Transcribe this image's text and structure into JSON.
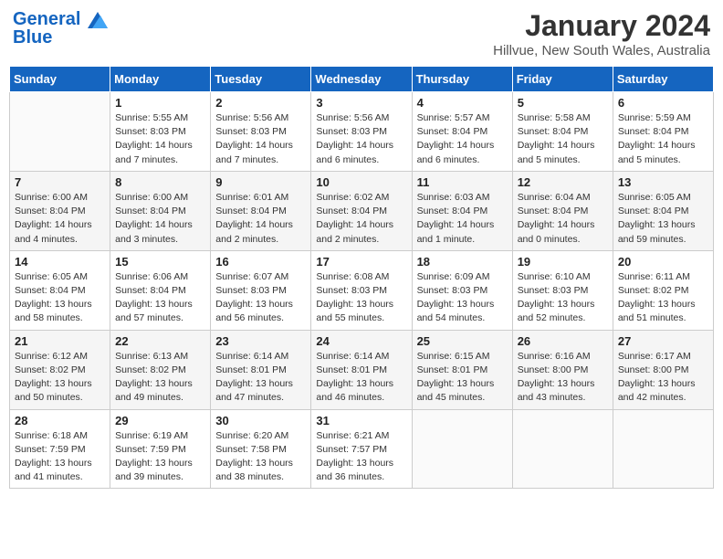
{
  "header": {
    "logo_line1": "General",
    "logo_line2": "Blue",
    "month": "January 2024",
    "location": "Hillvue, New South Wales, Australia"
  },
  "days_of_week": [
    "Sunday",
    "Monday",
    "Tuesday",
    "Wednesday",
    "Thursday",
    "Friday",
    "Saturday"
  ],
  "weeks": [
    [
      {
        "day": "",
        "sunrise": "",
        "sunset": "",
        "daylight": ""
      },
      {
        "day": "1",
        "sunrise": "Sunrise: 5:55 AM",
        "sunset": "Sunset: 8:03 PM",
        "daylight": "Daylight: 14 hours and 7 minutes."
      },
      {
        "day": "2",
        "sunrise": "Sunrise: 5:56 AM",
        "sunset": "Sunset: 8:03 PM",
        "daylight": "Daylight: 14 hours and 7 minutes."
      },
      {
        "day": "3",
        "sunrise": "Sunrise: 5:56 AM",
        "sunset": "Sunset: 8:03 PM",
        "daylight": "Daylight: 14 hours and 6 minutes."
      },
      {
        "day": "4",
        "sunrise": "Sunrise: 5:57 AM",
        "sunset": "Sunset: 8:04 PM",
        "daylight": "Daylight: 14 hours and 6 minutes."
      },
      {
        "day": "5",
        "sunrise": "Sunrise: 5:58 AM",
        "sunset": "Sunset: 8:04 PM",
        "daylight": "Daylight: 14 hours and 5 minutes."
      },
      {
        "day": "6",
        "sunrise": "Sunrise: 5:59 AM",
        "sunset": "Sunset: 8:04 PM",
        "daylight": "Daylight: 14 hours and 5 minutes."
      }
    ],
    [
      {
        "day": "7",
        "sunrise": "Sunrise: 6:00 AM",
        "sunset": "Sunset: 8:04 PM",
        "daylight": "Daylight: 14 hours and 4 minutes."
      },
      {
        "day": "8",
        "sunrise": "Sunrise: 6:00 AM",
        "sunset": "Sunset: 8:04 PM",
        "daylight": "Daylight: 14 hours and 3 minutes."
      },
      {
        "day": "9",
        "sunrise": "Sunrise: 6:01 AM",
        "sunset": "Sunset: 8:04 PM",
        "daylight": "Daylight: 14 hours and 2 minutes."
      },
      {
        "day": "10",
        "sunrise": "Sunrise: 6:02 AM",
        "sunset": "Sunset: 8:04 PM",
        "daylight": "Daylight: 14 hours and 2 minutes."
      },
      {
        "day": "11",
        "sunrise": "Sunrise: 6:03 AM",
        "sunset": "Sunset: 8:04 PM",
        "daylight": "Daylight: 14 hours and 1 minute."
      },
      {
        "day": "12",
        "sunrise": "Sunrise: 6:04 AM",
        "sunset": "Sunset: 8:04 PM",
        "daylight": "Daylight: 14 hours and 0 minutes."
      },
      {
        "day": "13",
        "sunrise": "Sunrise: 6:05 AM",
        "sunset": "Sunset: 8:04 PM",
        "daylight": "Daylight: 13 hours and 59 minutes."
      }
    ],
    [
      {
        "day": "14",
        "sunrise": "Sunrise: 6:05 AM",
        "sunset": "Sunset: 8:04 PM",
        "daylight": "Daylight: 13 hours and 58 minutes."
      },
      {
        "day": "15",
        "sunrise": "Sunrise: 6:06 AM",
        "sunset": "Sunset: 8:04 PM",
        "daylight": "Daylight: 13 hours and 57 minutes."
      },
      {
        "day": "16",
        "sunrise": "Sunrise: 6:07 AM",
        "sunset": "Sunset: 8:03 PM",
        "daylight": "Daylight: 13 hours and 56 minutes."
      },
      {
        "day": "17",
        "sunrise": "Sunrise: 6:08 AM",
        "sunset": "Sunset: 8:03 PM",
        "daylight": "Daylight: 13 hours and 55 minutes."
      },
      {
        "day": "18",
        "sunrise": "Sunrise: 6:09 AM",
        "sunset": "Sunset: 8:03 PM",
        "daylight": "Daylight: 13 hours and 54 minutes."
      },
      {
        "day": "19",
        "sunrise": "Sunrise: 6:10 AM",
        "sunset": "Sunset: 8:03 PM",
        "daylight": "Daylight: 13 hours and 52 minutes."
      },
      {
        "day": "20",
        "sunrise": "Sunrise: 6:11 AM",
        "sunset": "Sunset: 8:02 PM",
        "daylight": "Daylight: 13 hours and 51 minutes."
      }
    ],
    [
      {
        "day": "21",
        "sunrise": "Sunrise: 6:12 AM",
        "sunset": "Sunset: 8:02 PM",
        "daylight": "Daylight: 13 hours and 50 minutes."
      },
      {
        "day": "22",
        "sunrise": "Sunrise: 6:13 AM",
        "sunset": "Sunset: 8:02 PM",
        "daylight": "Daylight: 13 hours and 49 minutes."
      },
      {
        "day": "23",
        "sunrise": "Sunrise: 6:14 AM",
        "sunset": "Sunset: 8:01 PM",
        "daylight": "Daylight: 13 hours and 47 minutes."
      },
      {
        "day": "24",
        "sunrise": "Sunrise: 6:14 AM",
        "sunset": "Sunset: 8:01 PM",
        "daylight": "Daylight: 13 hours and 46 minutes."
      },
      {
        "day": "25",
        "sunrise": "Sunrise: 6:15 AM",
        "sunset": "Sunset: 8:01 PM",
        "daylight": "Daylight: 13 hours and 45 minutes."
      },
      {
        "day": "26",
        "sunrise": "Sunrise: 6:16 AM",
        "sunset": "Sunset: 8:00 PM",
        "daylight": "Daylight: 13 hours and 43 minutes."
      },
      {
        "day": "27",
        "sunrise": "Sunrise: 6:17 AM",
        "sunset": "Sunset: 8:00 PM",
        "daylight": "Daylight: 13 hours and 42 minutes."
      }
    ],
    [
      {
        "day": "28",
        "sunrise": "Sunrise: 6:18 AM",
        "sunset": "Sunset: 7:59 PM",
        "daylight": "Daylight: 13 hours and 41 minutes."
      },
      {
        "day": "29",
        "sunrise": "Sunrise: 6:19 AM",
        "sunset": "Sunset: 7:59 PM",
        "daylight": "Daylight: 13 hours and 39 minutes."
      },
      {
        "day": "30",
        "sunrise": "Sunrise: 6:20 AM",
        "sunset": "Sunset: 7:58 PM",
        "daylight": "Daylight: 13 hours and 38 minutes."
      },
      {
        "day": "31",
        "sunrise": "Sunrise: 6:21 AM",
        "sunset": "Sunset: 7:57 PM",
        "daylight": "Daylight: 13 hours and 36 minutes."
      },
      {
        "day": "",
        "sunrise": "",
        "sunset": "",
        "daylight": ""
      },
      {
        "day": "",
        "sunrise": "",
        "sunset": "",
        "daylight": ""
      },
      {
        "day": "",
        "sunrise": "",
        "sunset": "",
        "daylight": ""
      }
    ]
  ]
}
